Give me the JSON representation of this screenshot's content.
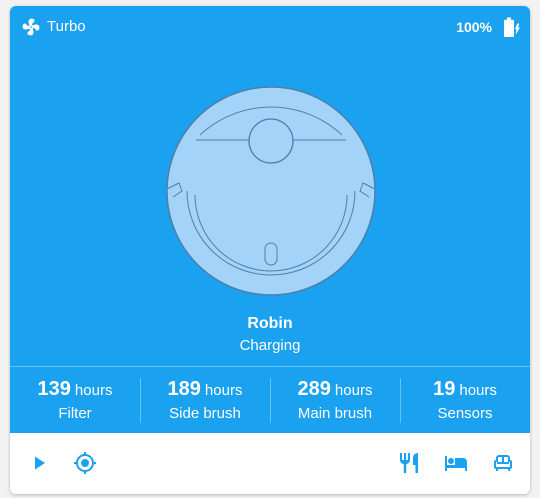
{
  "colors": {
    "card_blue": "#1aa1f0",
    "icon_blue": "#1aa1f0",
    "robot_fill": "#a3d3f8",
    "robot_stroke": "#4d7fa8"
  },
  "header": {
    "fan_mode": "Turbo",
    "fan_icon": "fan-icon",
    "battery_level": "100%",
    "battery_icon": "battery-charging-icon",
    "battery_fraction": 1.0
  },
  "vacuum": {
    "name": "Robin",
    "status": "Charging"
  },
  "stats": [
    {
      "value": "139",
      "unit": "hours",
      "label": "Filter"
    },
    {
      "value": "189",
      "unit": "hours",
      "label": "Side brush"
    },
    {
      "value": "289",
      "unit": "hours",
      "label": "Main brush"
    },
    {
      "value": "19",
      "unit": "hours",
      "label": "Sensors"
    }
  ],
  "toolbar": {
    "left": [
      "play-icon",
      "locate-icon"
    ],
    "right": [
      "kitchen-icon",
      "bed-icon",
      "sofa-icon"
    ]
  }
}
